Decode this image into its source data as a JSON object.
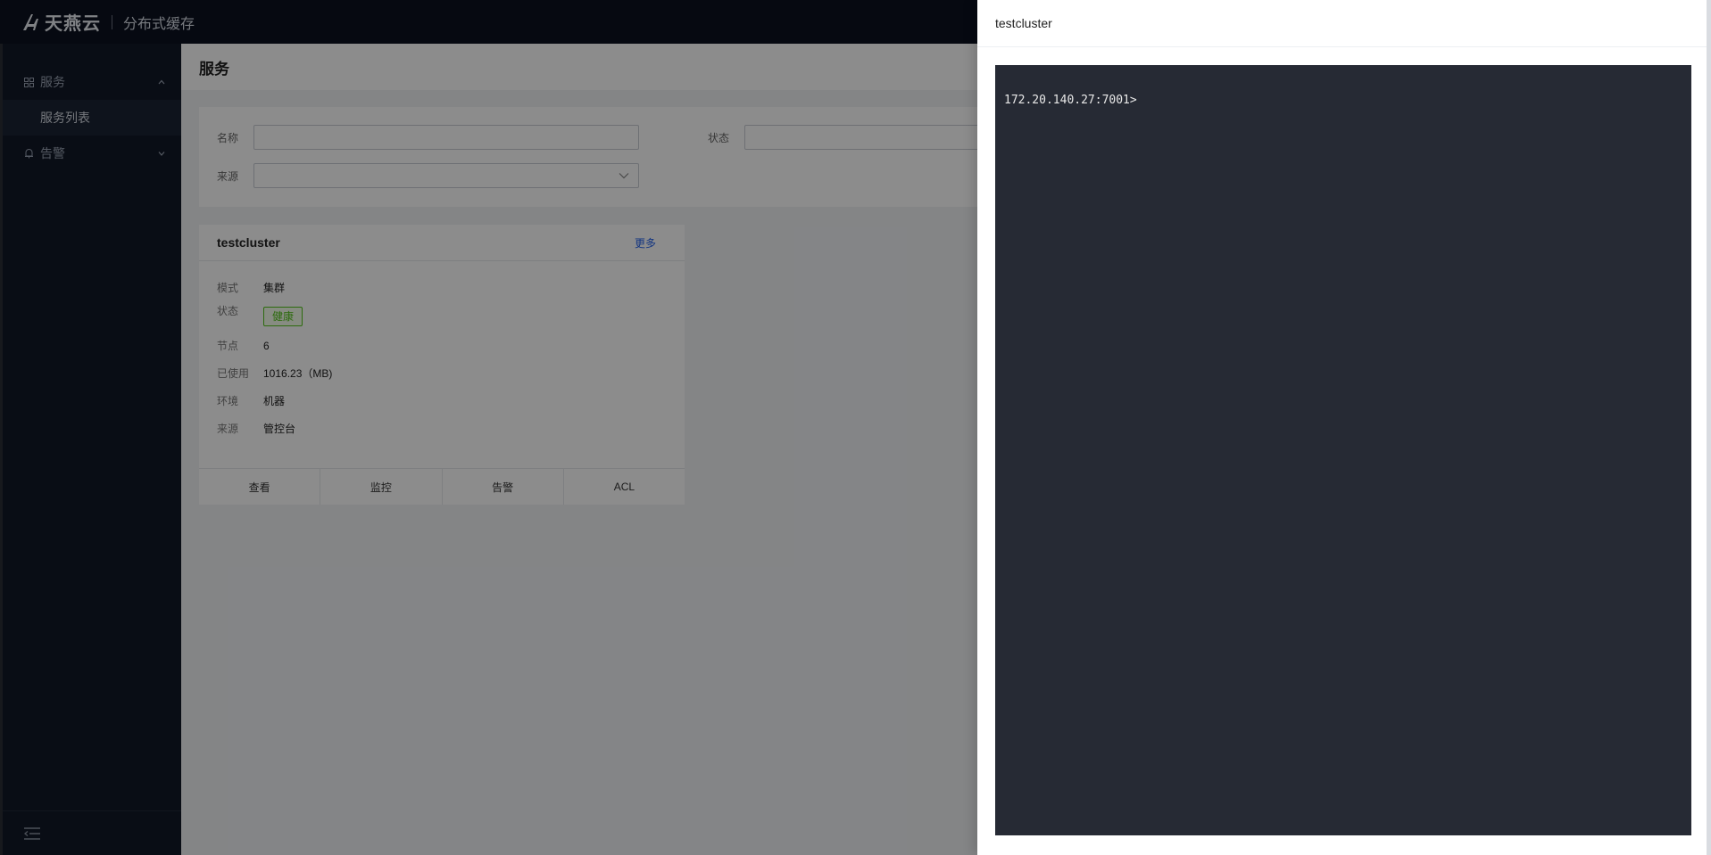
{
  "app": {
    "brand_name": "天燕云",
    "product_name": "分布式缓存"
  },
  "icons": {
    "logo": "swallow-logo-icon",
    "service_menu": "grid-icon",
    "alarm_menu": "bell-icon",
    "collapse": "collapse-menu-icon",
    "chevron_up": "chevron-up-icon",
    "chevron_down": "chevron-down-icon"
  },
  "sidebar": {
    "groups": [
      {
        "label": "服务",
        "expanded": true,
        "items": [
          {
            "label": "服务列表",
            "active": true
          }
        ]
      },
      {
        "label": "告警",
        "expanded": false
      }
    ]
  },
  "page": {
    "title": "服务"
  },
  "filters": {
    "name_label": "名称",
    "name_value": "",
    "status_label": "状态",
    "status_value": "",
    "source_label": "来源",
    "source_value": ""
  },
  "service_card": {
    "title": "testcluster",
    "more_label": "更多",
    "fields": [
      {
        "key": "模式",
        "value": "集群"
      },
      {
        "key": "状态",
        "value": "健康"
      },
      {
        "key": "节点",
        "value": "6"
      },
      {
        "key": "已使用",
        "value": "1016.23（MB)"
      },
      {
        "key": "环境",
        "value": "机器"
      },
      {
        "key": "来源",
        "value": "管控台"
      }
    ],
    "actions": [
      "查看",
      "监控",
      "告警",
      "ACL"
    ]
  },
  "drawer": {
    "title": "testcluster",
    "terminal_prompt": "172.20.140.27:7001>"
  },
  "colors": {
    "header_bg": "#0b1120",
    "sidebar_bg": "#111827",
    "terminal_bg": "#262a34",
    "healthy": "#52c41a",
    "link": "#2563eb"
  }
}
